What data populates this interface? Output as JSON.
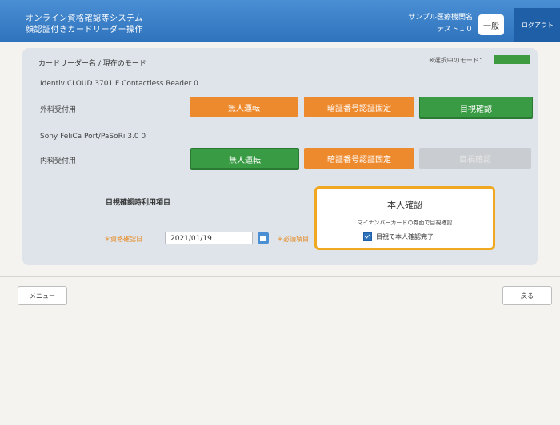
{
  "header": {
    "system_name": "オンライン資格確認等システム",
    "screen_name": "顔認証付きカードリーダー操作",
    "facility": "サンプル医療機関名",
    "user": "テスト１０",
    "mode_label": "一般",
    "logout_label": "ログアウト"
  },
  "breadcrumb": "カードリーダー名 / 現在のモード",
  "selected_mode_label": "※選択中のモード：",
  "readers": [
    {
      "name": "Identiv CLOUD 3701 F Contactless Reader 0",
      "department": "外科受付用"
    },
    {
      "name": "Sony FeliCa Port/PaSoRi 3.0 0",
      "department": "内科受付用"
    }
  ],
  "buttons": {
    "unattended": "無人運転",
    "pin_fixed": "暗証番号認証固定",
    "visual_check": "目視確認"
  },
  "visual_section": {
    "title": "目視確認時利用項目",
    "date_label": "＊資格確認日",
    "date_value": "2021/01/19",
    "required_label": "＊必須項目"
  },
  "identity_popup": {
    "title": "本人確認",
    "description": "マイナンバーカードの券面で目視確認",
    "checkbox_label": "目視で本人確認完了",
    "checked": true
  },
  "footer": {
    "menu_label": "メニュー",
    "back_label": "戻る"
  },
  "colors": {
    "header": "#2f73bd",
    "orange": "#ee8a2e",
    "green": "#3a9b45",
    "popup_border": "#f0a820"
  }
}
